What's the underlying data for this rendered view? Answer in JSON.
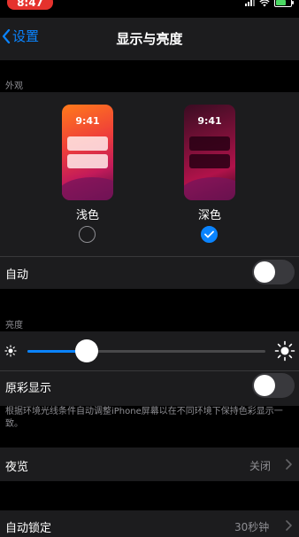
{
  "status_bar": {
    "time": "8:47"
  },
  "nav": {
    "back_label": "设置",
    "title": "显示与亮度"
  },
  "appearance": {
    "section_label": "外观",
    "light": {
      "preview_time": "9:41",
      "label": "浅色",
      "selected": false
    },
    "dark": {
      "preview_time": "9:41",
      "label": "深色",
      "selected": true
    },
    "automatic": {
      "label": "自动",
      "on": false
    }
  },
  "brightness": {
    "section_label": "亮度",
    "level": 0.25,
    "true_tone": {
      "label": "原彩显示",
      "on": false
    },
    "note": "根据环境光线条件自动调整iPhone屏幕以在不同环境下保持色彩显示一致。"
  },
  "night_shift": {
    "label": "夜览",
    "value": "关闭"
  },
  "auto_lock": {
    "label": "自动锁定",
    "value": "30秒钟"
  },
  "colors": {
    "accent": "#0a84ff",
    "status_time_bg": "#e5322d"
  }
}
